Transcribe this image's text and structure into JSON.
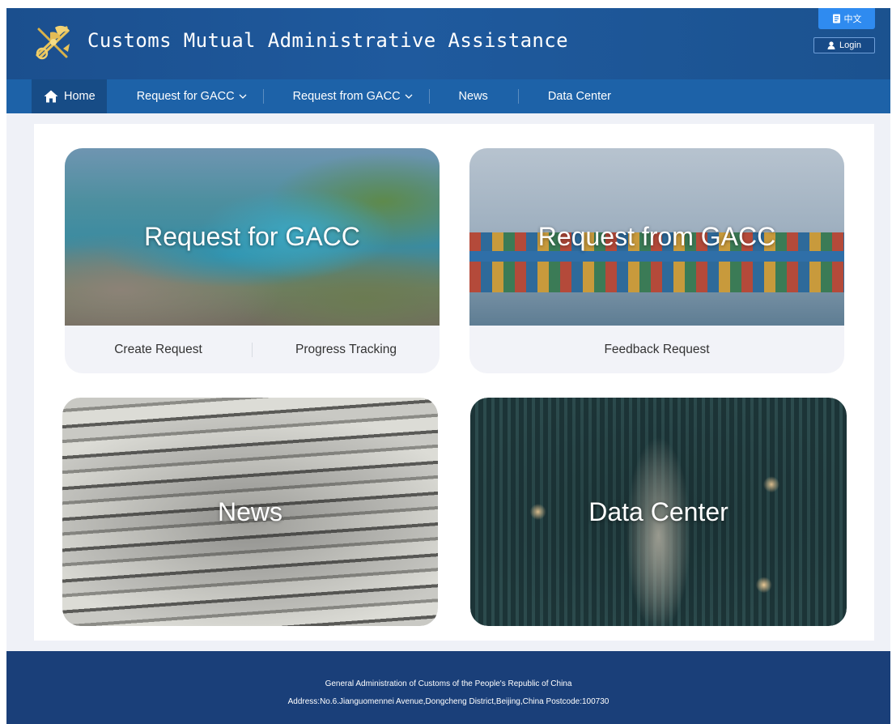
{
  "header": {
    "site_title": "Customs Mutual Administrative Assistance",
    "language_label": "中文",
    "login_label": "Login"
  },
  "nav": {
    "items": [
      {
        "label": "Home",
        "icon": "home-icon",
        "active": true
      },
      {
        "label": "Request for GACC",
        "icon": "chevron-down-icon"
      },
      {
        "label": "Request from GACC",
        "icon": "chevron-down-icon"
      },
      {
        "label": "News"
      },
      {
        "label": "Data Center"
      }
    ]
  },
  "cards": {
    "request_for": {
      "title": "Request for GACC",
      "links": [
        "Create Request",
        "Progress Tracking"
      ]
    },
    "request_from": {
      "title": "Request from GACC",
      "links": [
        "Feedback Request"
      ]
    },
    "news": {
      "title": "News"
    },
    "data_center": {
      "title": "Data Center"
    }
  },
  "footer": {
    "org": "General Administration of Customs of the People's Republic of China",
    "address": "Address:No.6.Jianguomennei Avenue,Dongcheng District,Beijing,China Postcode:100730"
  },
  "colors": {
    "header_bg": "#1f5a9e",
    "nav_bg": "#1d62a8",
    "footer_bg": "#1a3f79",
    "lang_button": "#2f8bf0"
  }
}
